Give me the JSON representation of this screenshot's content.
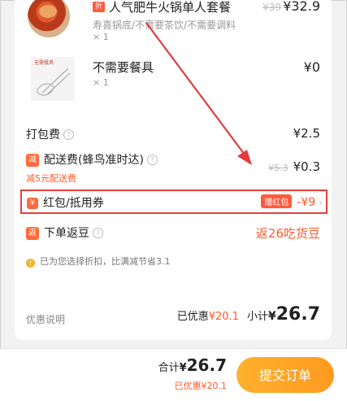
{
  "items": [
    {
      "badge": "折",
      "title": "人气肥牛火锅单人套餐",
      "desc": "寿喜锅底/不需要茶饮/不需要调料",
      "qty": "× 1",
      "old_price": "¥39",
      "price": "¥32.9",
      "icon": "hotpot-image"
    },
    {
      "tag": "无需餐具",
      "title": "不需要餐具",
      "qty": "× 1",
      "price": "¥0",
      "icon": "chopsticks-icon"
    }
  ],
  "fees": {
    "packing": {
      "label": "打包费",
      "value": "¥2.5"
    },
    "delivery": {
      "icon_text": "减",
      "label": "配送费(蜂鸟准时达)",
      "old_value": "¥5.3",
      "value": "¥0.3",
      "note": "减5元配送费"
    }
  },
  "coupon": {
    "icon_text": "¥",
    "label": "红包/抵用券",
    "tag": "赠红包",
    "value": "-¥9"
  },
  "rebate": {
    "icon_text": "返",
    "label": "下单返豆",
    "value": "返26吃货豆"
  },
  "notice": {
    "icon_text": "!",
    "text": "已为您选择折扣，比满减节省3.1"
  },
  "summary": {
    "help": "优惠说明",
    "saved_label": "已优惠",
    "saved_value": "¥20.1",
    "subtotal_label": "小计",
    "subtotal_currency": "¥",
    "subtotal_value": "26.7"
  },
  "bottom": {
    "total_label": "合计",
    "total_currency": "¥",
    "total_value": "26.7",
    "saved_text": "已优惠¥20.1",
    "submit": "提交订单"
  },
  "colors": {
    "accent": "#ff5a2b",
    "highlight_border": "#e2403a",
    "submit_start": "#ffb02e",
    "submit_end": "#ff9a1f"
  }
}
